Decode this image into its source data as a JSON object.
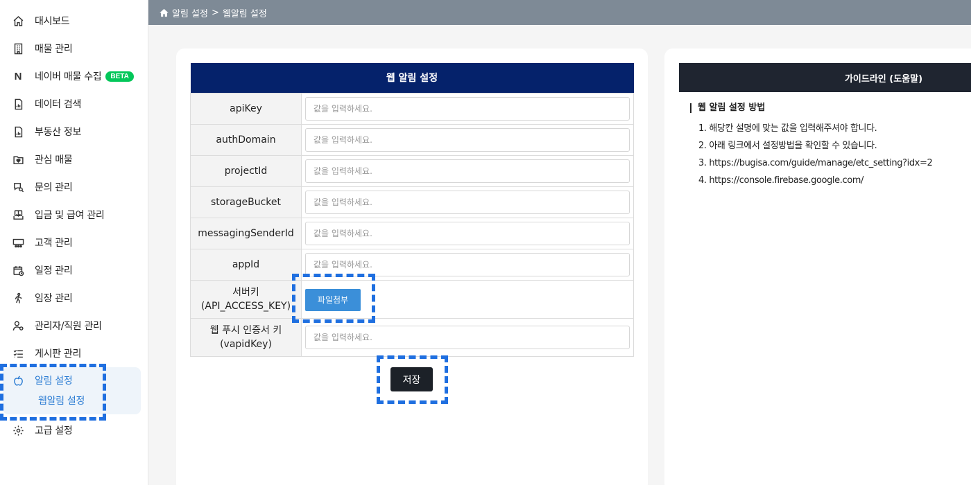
{
  "breadcrumb": {
    "section": "알림 설정",
    "separator": ">",
    "page": "웹알림 설정"
  },
  "sidebar": {
    "items": [
      {
        "label": "대시보드",
        "icon": "home-icon"
      },
      {
        "label": "매물 관리",
        "icon": "building-icon"
      },
      {
        "label": "네이버 매물 수집",
        "icon": "naver-n-icon",
        "badge": "BETA"
      },
      {
        "label": "데이터 검색",
        "icon": "document-chart-icon"
      },
      {
        "label": "부동산 정보",
        "icon": "document-chart-icon"
      },
      {
        "label": "관심 매물",
        "icon": "heart-folder-icon"
      },
      {
        "label": "문의 관리",
        "icon": "chat-search-icon"
      },
      {
        "label": "입금 및 급여 관리",
        "icon": "download-tray-icon"
      },
      {
        "label": "고객 관리",
        "icon": "people-group-icon"
      },
      {
        "label": "일정 관리",
        "icon": "calendar-clock-icon"
      },
      {
        "label": "임장 관리",
        "icon": "walking-person-icon"
      },
      {
        "label": "관리자/직원 관리",
        "icon": "user-gear-icon"
      },
      {
        "label": "게시판 관리",
        "icon": "checklist-icon"
      }
    ],
    "active": {
      "label": "알림 설정",
      "icon": "apple-icon",
      "sub": "웹알림 설정"
    },
    "last": {
      "label": "고급 설정",
      "icon": "gear-icon"
    }
  },
  "form": {
    "title": "웹 알림 설정",
    "placeholder": "값을 입력하세요.",
    "rows": [
      {
        "label": "apiKey"
      },
      {
        "label": "authDomain"
      },
      {
        "label": "projectId"
      },
      {
        "label": "storageBucket"
      },
      {
        "label": "messagingSenderId"
      },
      {
        "label": "appId"
      }
    ],
    "server_key": {
      "label_line1": "서버키",
      "label_line2": "(API_ACCESS_KEY)",
      "button": "파일첨부"
    },
    "vapid": {
      "label_line1": "웹 푸시 인증서 키",
      "label_line2": "(vapidKey)"
    },
    "save": "저장"
  },
  "guide": {
    "header": "가이드라인 (도움말)",
    "title": "웹 알림 설정 방법",
    "items": [
      "1. 해당칸 설명에 맞는 값을 입력해주셔야 합니다.",
      "2. 아래 링크에서 설정방법을 확인할 수 있습니다.",
      "3. https://bugisa.com/guide/manage/etc_setting?idx=2",
      "4. https://console.firebase.google.com/"
    ]
  },
  "colors": {
    "accent": "#2b7cd3",
    "header_navy": "#05226b",
    "naver_green": "#03c75a",
    "highlight": "#1f6fe0"
  }
}
